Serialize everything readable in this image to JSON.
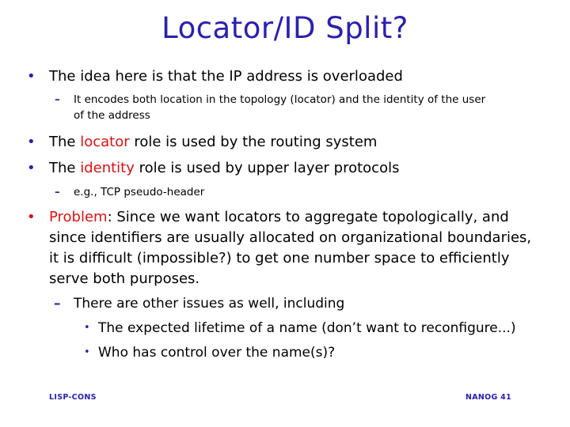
{
  "title": "Locator/ID Split?",
  "bullet_glyph": "•",
  "dash_glyph": "–",
  "items": [
    {
      "text": "The idea here is that the IP address is overloaded"
    },
    {
      "line1": "It encodes both location in the topology (locator) and the identity of the user",
      "line2": "of the address"
    },
    {
      "prefix": "The ",
      "highlight": "locator",
      "suffix": " role is used by the routing system"
    },
    {
      "prefix": "The ",
      "highlight": "identity",
      "suffix": " role is used by upper layer protocols"
    },
    {
      "text": "e.g., TCP pseudo-header"
    },
    {
      "highlight": "Problem",
      "line1_rest": ": Since we want locators to aggregate topologically, and",
      "line2": "since identifiers are usually allocated on organizational boundaries,",
      "line3": "it is difficult (impossible?) to get one number space to efficiently",
      "line4": "serve both purposes."
    },
    {
      "text": "There are other issues as well, including"
    },
    {
      "text": "The expected lifetime of a name (don’t want to reconfigure...)"
    },
    {
      "text": "Who has control over the name(s)?"
    }
  ],
  "footer": {
    "left": "LISP-CONS",
    "right": "NANOG 41"
  },
  "colors": {
    "title": "#2a20b0",
    "accent": "#dd1111",
    "text": "#000000"
  }
}
